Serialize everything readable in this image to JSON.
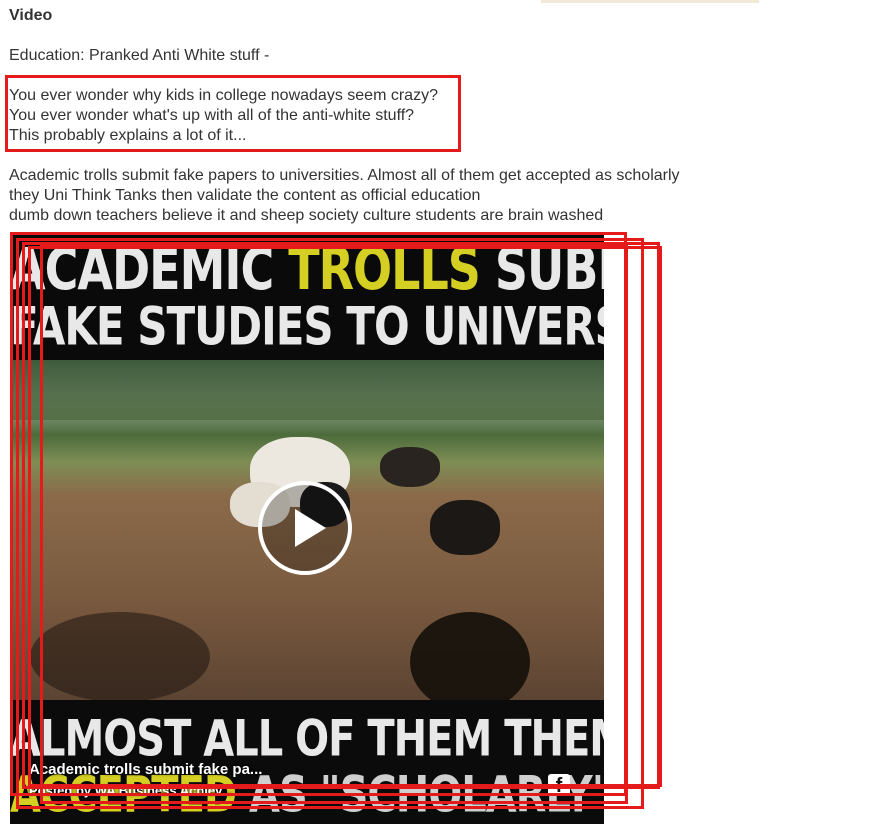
{
  "post": {
    "heading": "Video",
    "education_line": "Education: Pranked Anti White stuff  -",
    "questions": [
      "You ever wonder why kids in college nowadays seem crazy?",
      "You ever wonder what's up with all of the anti-white stuff?",
      "This probably explains a lot of it..."
    ],
    "paragraph": [
      "Academic trolls submit fake papers to universities. Almost all of them get accepted as scholarly",
      "they Uni Think Tanks then validate the content as official education",
      "dumb down teachers believe it and sheep society culture students are brain washed"
    ]
  },
  "video": {
    "caption_line1_a": "ACADEMIC ",
    "caption_line1_b": "TROLLS",
    "caption_line1_c": " SUBMIT",
    "caption_line2": "FAKE STUDIES TO UNIVERSITIES",
    "caption_line3": "ALMOST ALL OF THEM THEM ARE",
    "caption_line4_a": "ACCEPTED",
    "caption_line4_b": " AS \"SCHOLARLY\" WORKS",
    "title": "Academic trolls submit fake pa...",
    "posted_by": "Posted by WA Business Achiev...",
    "play_icon": "play-icon",
    "source_icon": "facebook-icon"
  },
  "colors": {
    "highlight": "#e51b1b",
    "caption_accent": "#d4cf22"
  }
}
